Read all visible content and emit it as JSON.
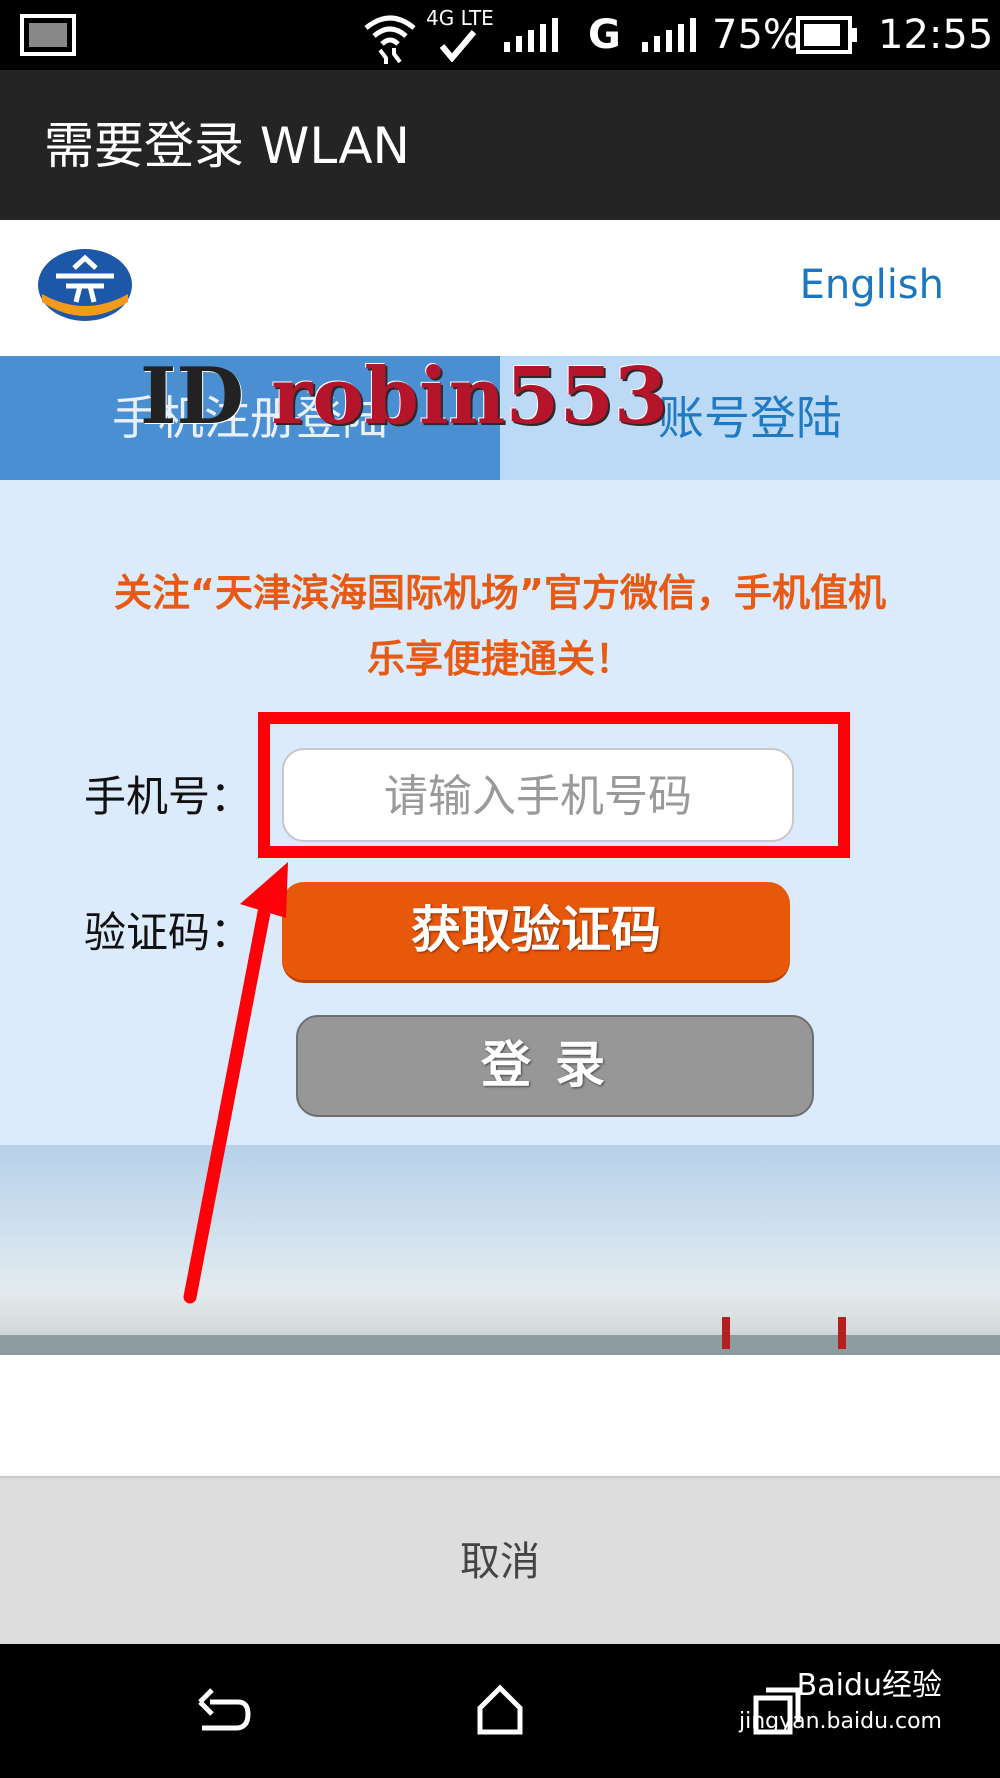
{
  "status_bar": {
    "network": "4G LTE",
    "carrier_g": "G",
    "battery": "75%",
    "time": "12:55"
  },
  "title_bar": {
    "title": "需要登录 WLAN"
  },
  "header": {
    "language_link": "English"
  },
  "tabs": [
    {
      "label": "手机注册登陆",
      "active": true
    },
    {
      "label": "账号登陆",
      "active": false
    }
  ],
  "form": {
    "notice": "关注“天津滨海国际机场”官方微信，手机值机乐享便捷通关！",
    "phone_label": "手机号：",
    "phone_placeholder": "请输入手机号码",
    "code_label": "验证码：",
    "get_code_button": "获取验证码",
    "login_button": "登录"
  },
  "watermark": {
    "id": "ID",
    "name": "robin553"
  },
  "cancel_button": "取消",
  "baidu_badge": {
    "text": "Baidu经验",
    "url_text": "jingyan.baidu.com"
  },
  "colors": {
    "accent_blue": "#1a78c2",
    "active_tab": "#4a8fd1",
    "form_bg": "#dbebfb",
    "orange": "#e8580a",
    "highlight_red": "#ff0008"
  }
}
